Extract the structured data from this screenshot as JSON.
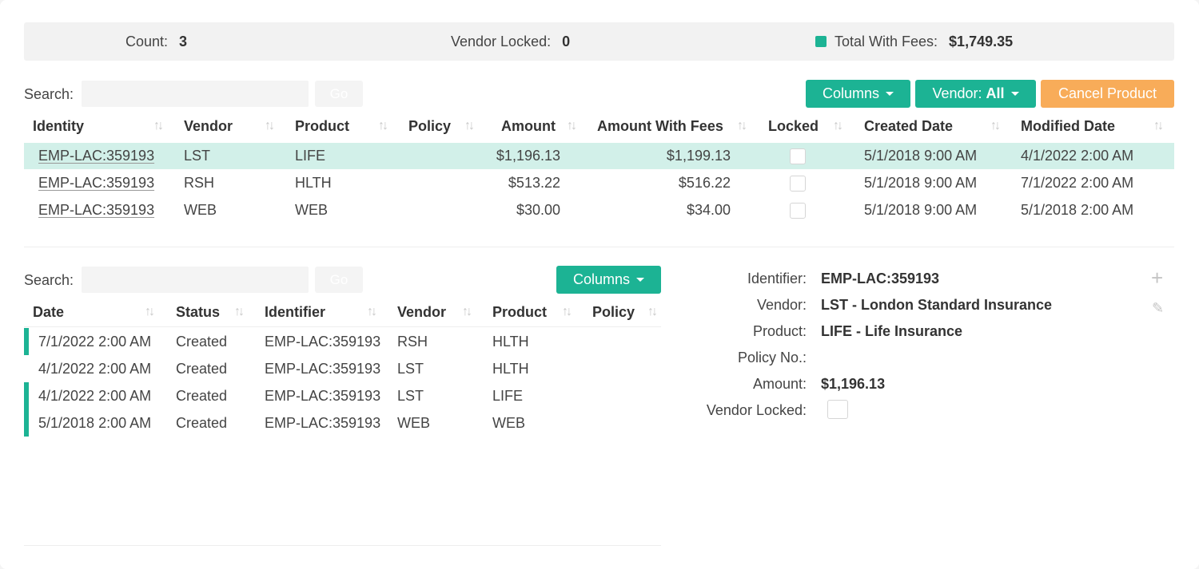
{
  "summary": {
    "count_label": "Count:",
    "count_value": "3",
    "locked_label": "Vendor Locked:",
    "locked_value": "0",
    "total_label": "Total With Fees:",
    "total_value": "$1,749.35"
  },
  "products": {
    "search_label": "Search:",
    "search_value": "",
    "go_label": "Go",
    "columns_button": "Columns",
    "vendor_button_prefix": "Vendor:",
    "vendor_button_value": "All",
    "cancel_button": "Cancel Product",
    "headers": [
      "Identity",
      "Vendor",
      "Product",
      "Policy",
      "Amount",
      "Amount With Fees",
      "Locked",
      "Created Date",
      "Modified Date"
    ],
    "rows": [
      {
        "identity": "EMP-LAC:359193",
        "vendor": "LST",
        "product": "LIFE",
        "policy": "",
        "amount": "$1,196.13",
        "amount_fees": "$1,199.13",
        "locked": false,
        "created": "5/1/2018 9:00 AM",
        "modified": "4/1/2022 2:00 AM"
      },
      {
        "identity": "EMP-LAC:359193",
        "vendor": "RSH",
        "product": "HLTH",
        "policy": "",
        "amount": "$513.22",
        "amount_fees": "$516.22",
        "locked": false,
        "created": "5/1/2018 9:00 AM",
        "modified": "7/1/2022 2:00 AM"
      },
      {
        "identity": "EMP-LAC:359193",
        "vendor": "WEB",
        "product": "WEB",
        "policy": "",
        "amount": "$30.00",
        "amount_fees": "$34.00",
        "locked": false,
        "created": "5/1/2018 9:00 AM",
        "modified": "5/1/2018 2:00 AM"
      }
    ],
    "selected_row": 0
  },
  "history": {
    "search_label": "Search:",
    "search_value": "",
    "go_label": "Go",
    "columns_button": "Columns",
    "headers": [
      "Date",
      "Status",
      "Identifier",
      "Vendor",
      "Product",
      "Policy"
    ],
    "rows": [
      {
        "date": "7/1/2022 2:00 AM",
        "status": "Created",
        "identifier": "EMP-LAC:359193",
        "vendor": "RSH",
        "product": "HLTH",
        "policy": "",
        "marked": true
      },
      {
        "date": "4/1/2022 2:00 AM",
        "status": "Created",
        "identifier": "EMP-LAC:359193",
        "vendor": "LST",
        "product": "HLTH",
        "policy": "",
        "marked": false
      },
      {
        "date": "4/1/2022 2:00 AM",
        "status": "Created",
        "identifier": "EMP-LAC:359193",
        "vendor": "LST",
        "product": "LIFE",
        "policy": "",
        "marked": true
      },
      {
        "date": "5/1/2018 2:00 AM",
        "status": "Created",
        "identifier": "EMP-LAC:359193",
        "vendor": "WEB",
        "product": "WEB",
        "policy": "",
        "marked": true
      }
    ]
  },
  "detail": {
    "identifier_label": "Identifier:",
    "identifier_value": "EMP-LAC:359193",
    "vendor_label": "Vendor:",
    "vendor_value": "LST - London Standard Insurance",
    "product_label": "Product:",
    "product_value": "LIFE - Life Insurance",
    "policy_label": "Policy No.:",
    "policy_value": "",
    "amount_label": "Amount:",
    "amount_value": "$1,196.13",
    "locked_label": "Vendor Locked:",
    "locked_value": false,
    "add_icon": "plus-icon",
    "edit_icon": "pencil-icon"
  },
  "colors": {
    "accent": "#1cb394",
    "warning": "#f8ac59",
    "selected_row": "#d2f0e9"
  }
}
